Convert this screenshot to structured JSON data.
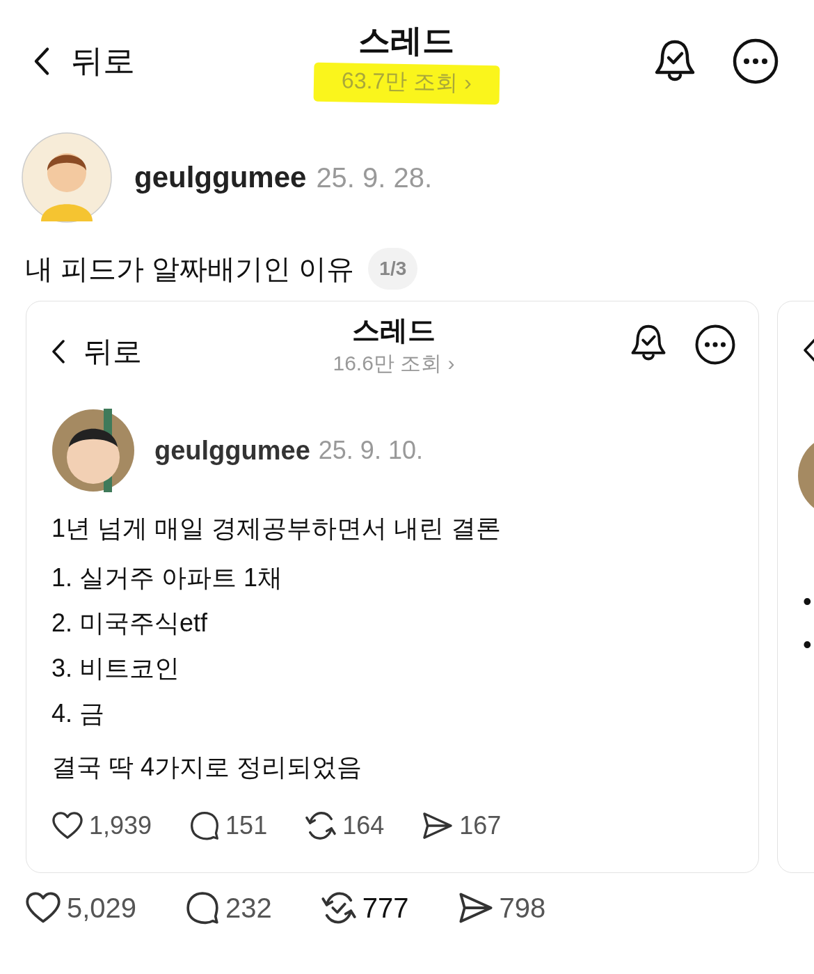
{
  "header": {
    "back_label": "뒤로",
    "title": "스레드",
    "views": "63.7만 조회",
    "views_chevron": "›",
    "highlighted": true
  },
  "post": {
    "username": "geulggumee",
    "date": "25. 9. 28.",
    "text": "내 피드가 알짜배기인 이유",
    "page_badge": "1/3",
    "cards": [
      {
        "kind": "screenshot",
        "back_label": "뒤로",
        "title": "스레드",
        "views": "16.6만 조회",
        "views_chevron": "›",
        "username": "geulggumee",
        "date": "25. 9. 10.",
        "paragraphs": [
          "1년 넘게 매일 경제공부하면서 내린 결론"
        ],
        "list": [
          "1. 실거주 아파트 1채",
          "2. 미국주식etf",
          "3. 비트코인",
          "4. 금"
        ],
        "closing": "결국 딱 4가지로 정리되었음",
        "stats": [
          {
            "kind": "like",
            "count": "1,939",
            "active": false
          },
          {
            "kind": "reply",
            "count": "151",
            "active": false
          },
          {
            "kind": "repost",
            "count": "164",
            "active": false
          },
          {
            "kind": "share",
            "count": "167",
            "active": false
          }
        ]
      },
      {
        "kind": "partial",
        "bullets": [
          "•",
          "•"
        ]
      }
    ],
    "stats": [
      {
        "kind": "like",
        "count": "5,029",
        "active": false
      },
      {
        "kind": "reply",
        "count": "232",
        "active": false
      },
      {
        "kind": "repost",
        "count": "777",
        "active": true
      },
      {
        "kind": "share",
        "count": "798",
        "active": false
      }
    ]
  }
}
